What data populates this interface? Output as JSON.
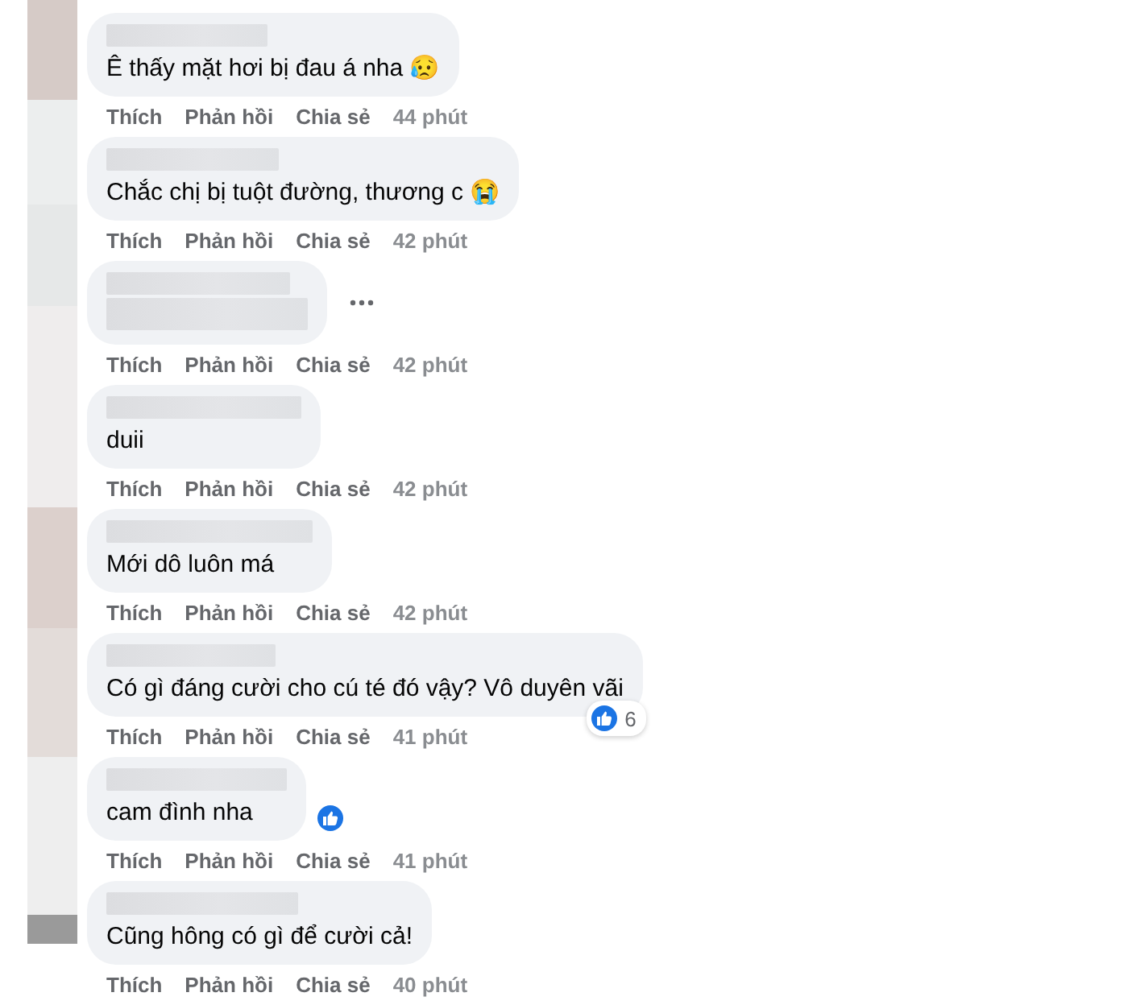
{
  "comments": [
    {
      "text": "Ê thấy mặt hơi bị đau á nha 😥",
      "text_hidden": false,
      "menu_shown": false,
      "reacted": false,
      "actions": [
        "Thích",
        "Phản hồi",
        "Chia sẻ"
      ],
      "time": "44 phút"
    },
    {
      "text": "Chắc chị bị tuột đường, thương c 😭",
      "text_hidden": false,
      "menu_shown": false,
      "reacted": false,
      "actions": [
        "Thích",
        "Phản hồi",
        "Chia sẻ"
      ],
      "time": "42 phút"
    },
    {
      "text_hidden": true,
      "menu_shown": true,
      "reacted": false,
      "actions": [
        "Thích",
        "Phản hồi",
        "Chia sẻ"
      ],
      "time": "42 phút"
    },
    {
      "text": "duii",
      "text_hidden": false,
      "menu_shown": false,
      "reacted": false,
      "actions": [
        "Thích",
        "Phản hồi",
        "Chia sẻ"
      ],
      "time": "42 phút"
    },
    {
      "text": "Mới dô luôn má",
      "text_hidden": false,
      "menu_shown": false,
      "reacted": false,
      "actions": [
        "Thích",
        "Phản hồi",
        "Chia sẻ"
      ],
      "time": "42 phút"
    },
    {
      "text": "Có gì đáng cười cho cú té đó vậy? Vô duyên vãi",
      "text_hidden": false,
      "menu_shown": false,
      "reacted": true,
      "reaction_count": "6",
      "actions": [
        "Thích",
        "Phản hồi",
        "Chia sẻ"
      ],
      "time": "41 phút"
    },
    {
      "text": "cam đình nha",
      "text_hidden": false,
      "menu_shown": false,
      "reacted": true,
      "actions": [
        "Thích",
        "Phản hồi",
        "Chia sẻ"
      ],
      "time": "41 phút"
    },
    {
      "text": "Cũng hông có gì để cười cả!",
      "text_hidden": false,
      "menu_shown": false,
      "reacted": false,
      "actions": [
        "Thích",
        "Phản hồi",
        "Chia sẻ"
      ],
      "time": "40 phút"
    }
  ]
}
